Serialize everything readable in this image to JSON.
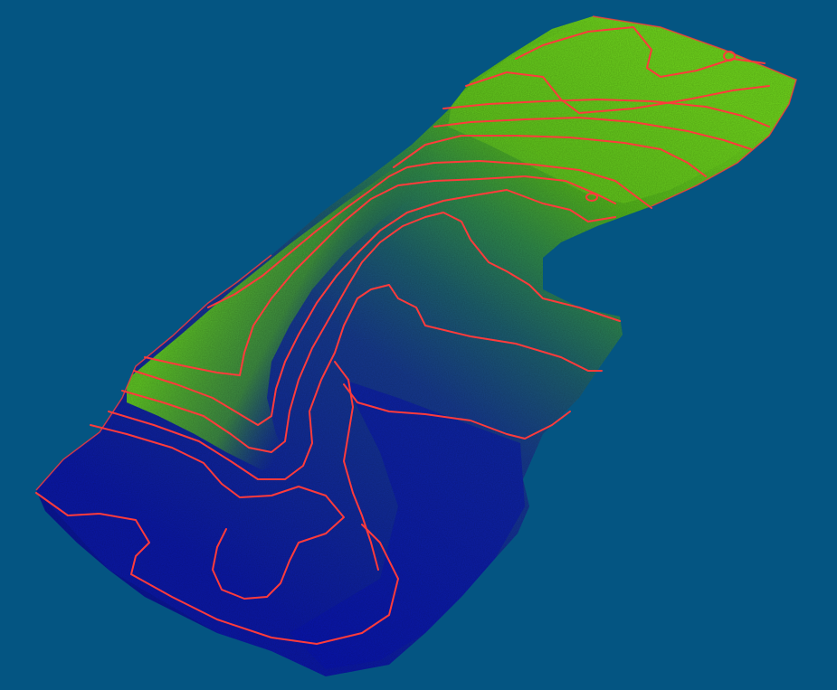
{
  "scene": {
    "background_color": "#045582",
    "surface_type": "3D terrain elevation model",
    "color_ramp": {
      "low": "#0e1fa8",
      "mid": "#1f6a78",
      "high": "#55c41a",
      "peak": "#7ddc1e"
    },
    "contour_color": "#ff3b3b",
    "contour_line_count": 14,
    "hillshade": true
  }
}
